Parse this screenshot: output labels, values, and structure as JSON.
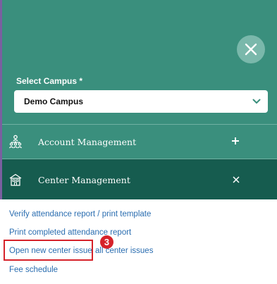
{
  "campus": {
    "label": "Select Campus *",
    "selected": "Demo Campus"
  },
  "menu": {
    "account": {
      "title": "Account Management",
      "toggle": "+"
    },
    "center": {
      "title": "Center Management",
      "toggle": "×"
    }
  },
  "links": [
    "Verify attendance report / print template",
    "Print completed attendance report",
    "Open new center issue",
    "all center issues",
    "Fee schedule"
  ],
  "annotation": {
    "badge": "3",
    "color": "#d6222a"
  },
  "colors": {
    "header_bg": "#3a8f7d",
    "active_row_bg": "#165c4f",
    "link": "#2a6db0",
    "close_button_bg": "#7ab8ab"
  },
  "icons": {
    "close": "close-icon",
    "select": "chevron-down-icon",
    "account": "org-chart-icon",
    "center": "building-icon"
  }
}
